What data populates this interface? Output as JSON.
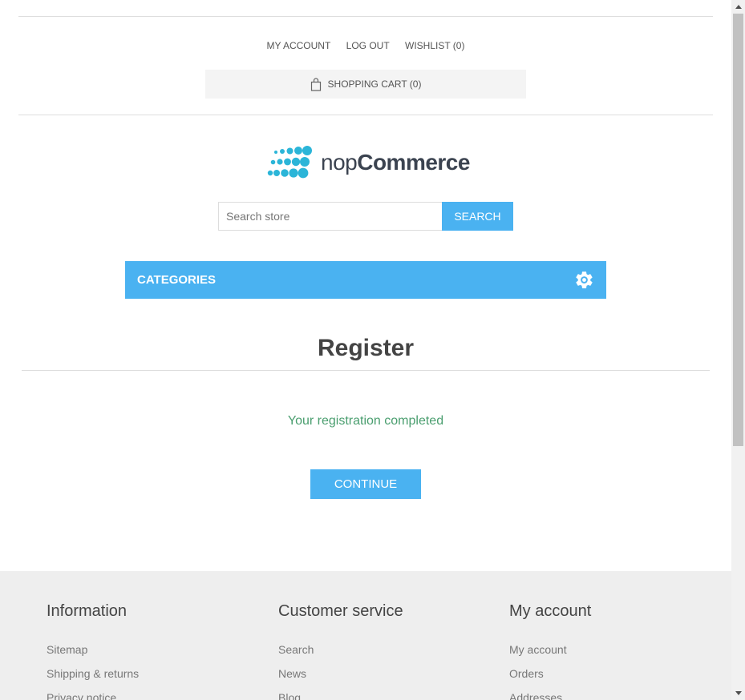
{
  "header": {
    "links": [
      {
        "label": "MY ACCOUNT"
      },
      {
        "label": "LOG OUT"
      },
      {
        "label": "WISHLIST (0)"
      }
    ],
    "cart_label": "SHOPPING CART (0)"
  },
  "logo": {
    "text_light": "nop",
    "text_bold": "Commerce"
  },
  "search": {
    "placeholder": "Search store",
    "button_label": "SEARCH"
  },
  "categories": {
    "label": "CATEGORIES",
    "icon": "gear-icon"
  },
  "main": {
    "title": "Register",
    "result": "Your registration completed",
    "continue_label": "CONTINUE"
  },
  "footer": {
    "columns": [
      {
        "title": "Information",
        "items": [
          "Sitemap",
          "Shipping & returns",
          "Privacy notice"
        ]
      },
      {
        "title": "Customer service",
        "items": [
          "Search",
          "News",
          "Blog"
        ]
      },
      {
        "title": "My account",
        "items": [
          "My account",
          "Orders",
          "Addresses"
        ]
      }
    ]
  },
  "colors": {
    "accent": "#4ab2f1",
    "result_text": "#4a9e6f",
    "logo_dots": "#2bb5d8"
  }
}
